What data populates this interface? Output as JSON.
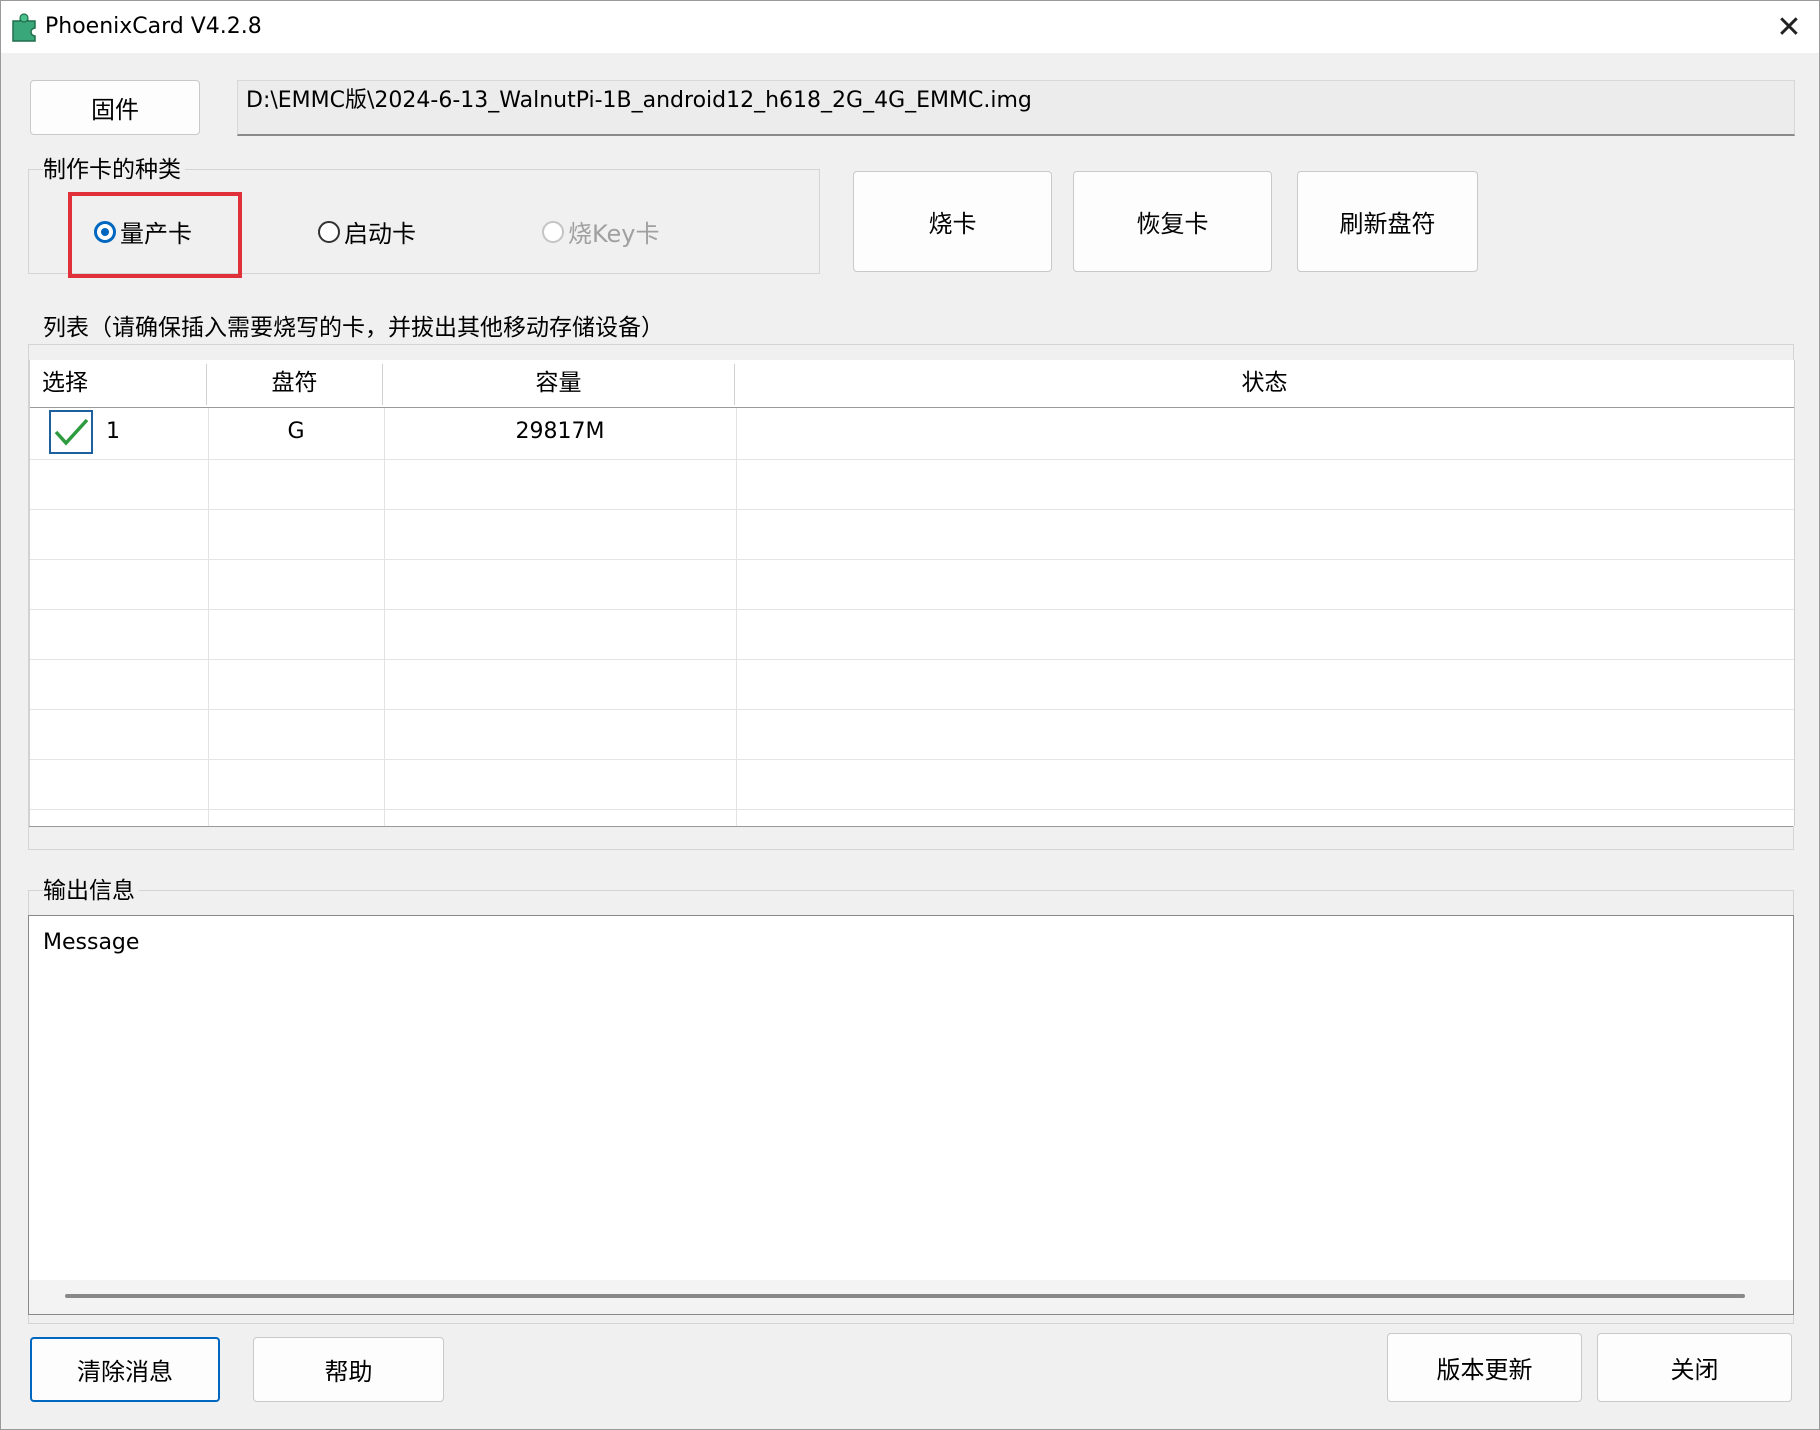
{
  "window": {
    "title": "PhoenixCard V4.2.8",
    "app_icon": "phoenixcard-puzzle-icon",
    "close_glyph": "✕"
  },
  "firmware": {
    "button_label": "固件",
    "path": "D:\\EMMC版\\2024-6-13_WalnutPi-1B_android12_h618_2G_4G_EMMC.img"
  },
  "card_type": {
    "legend": "制作卡的种类",
    "options": [
      {
        "label": "量产卡",
        "selected": true,
        "enabled": true
      },
      {
        "label": "启动卡",
        "selected": false,
        "enabled": true
      },
      {
        "label": "烧Key卡",
        "selected": false,
        "enabled": false
      }
    ]
  },
  "actions": {
    "burn": "烧卡",
    "restore": "恢复卡",
    "refresh": "刷新盘符"
  },
  "device_list": {
    "legend": "列表（请确保插入需要烧写的卡，并拔出其他移动存储设备）",
    "columns": [
      "选择",
      "盘符",
      "容量",
      "状态"
    ],
    "rows": [
      {
        "checked": true,
        "index": "1",
        "drive": "G",
        "capacity": "29817M",
        "status": ""
      }
    ]
  },
  "output": {
    "legend": "输出信息",
    "message": "Message"
  },
  "footer": {
    "clear": "清除消息",
    "help": "帮助",
    "update": "版本更新",
    "close": "关闭"
  },
  "colors": {
    "accent": "#0067c0",
    "highlight": "#e0303a",
    "check": "#2e9b3f"
  }
}
